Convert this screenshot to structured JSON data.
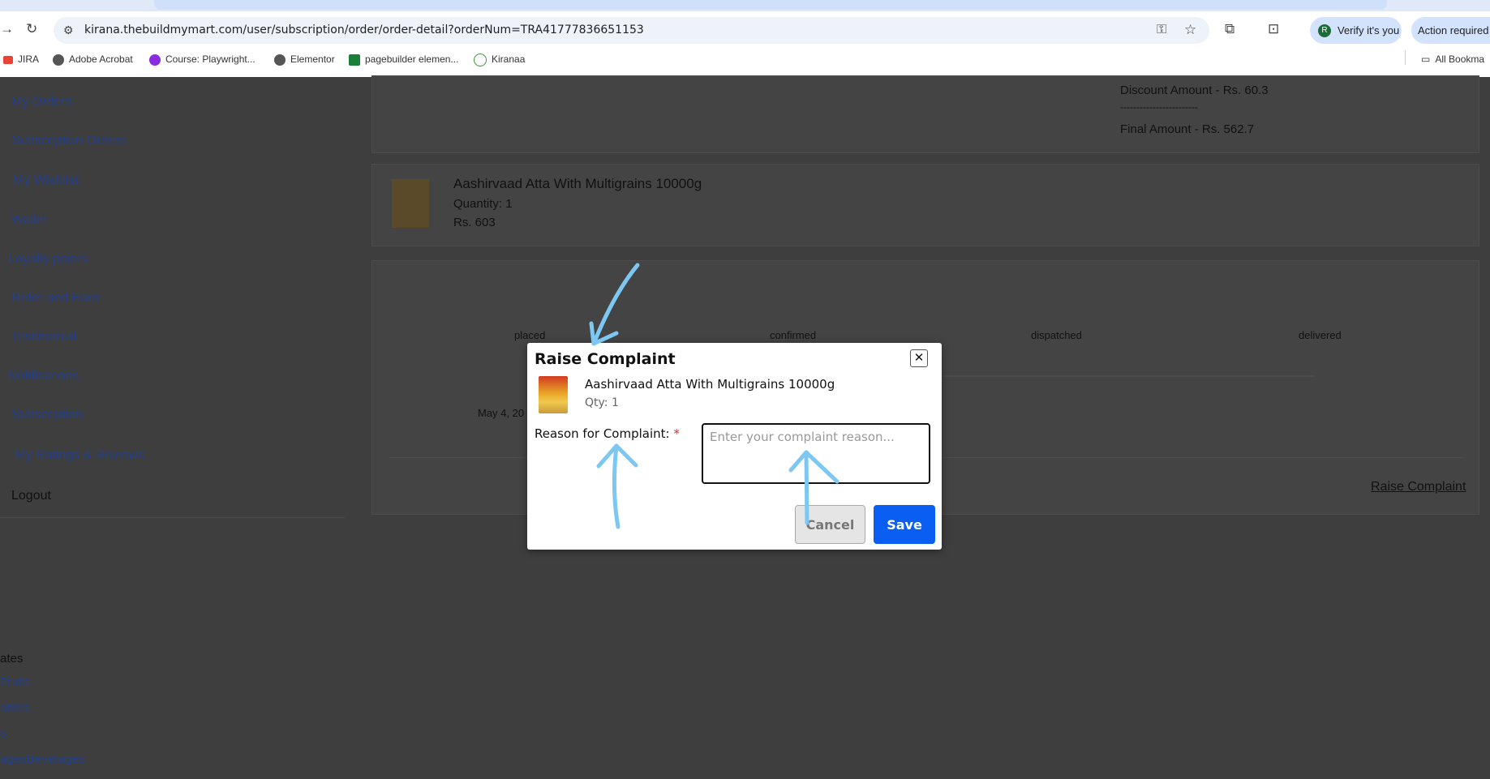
{
  "browser": {
    "url": "kirana.thebuildmymart.com/user/subscription/order/order-detail?orderNum=TRA41777836651153",
    "verify_label": "Verify it's you",
    "verify_avatar": "R",
    "action_label": "Action required",
    "bookmarks": [
      "JIRA",
      "Adobe Acrobat",
      "Course: Playwright...",
      "Elementor",
      "pagebuilder elemen...",
      "Kiranaa"
    ],
    "all_bookmarks": "All Bookma"
  },
  "sidebar": {
    "items": [
      "My Orders",
      "Subscription Orders",
      "My Wishlist",
      "Wallet",
      "Loyalty points",
      "Refer and Earn",
      "Testimonial",
      "Notifications",
      "Subscription",
      "My Ratings & Reviews",
      "Logout"
    ]
  },
  "categories": {
    "heading": "ates",
    "items": [
      "Fruits",
      "ables",
      "s",
      "agesBeverages"
    ]
  },
  "summary": {
    "discount": "Discount Amount - Rs. 60.3",
    "divider": "------------------------",
    "final": "Final Amount - Rs. 562.7"
  },
  "product": {
    "name": "Aashirvaad Atta With Multigrains 10000g",
    "quantity": "Quantity: 1",
    "price": "Rs. 603"
  },
  "tracker": {
    "steps": [
      "placed",
      "confirmed",
      "dispatched",
      "delivered"
    ],
    "date": "May 4, 20",
    "raise_link": "Raise Complaint"
  },
  "modal": {
    "title": "Raise Complaint",
    "product_name": "Aashirvaad Atta With Multigrains 10000g",
    "qty": "Qty: 1",
    "reason_label": "Reason for Complaint:",
    "required_mark": "*",
    "reason_placeholder": "Enter your complaint reason...",
    "cancel_label": "Cancel",
    "save_label": "Save",
    "close_glyph": "✕"
  },
  "colors": {
    "accent": "#0b5ef2",
    "sidebar_link": "#23408c",
    "annotation": "#7cc8f2"
  }
}
